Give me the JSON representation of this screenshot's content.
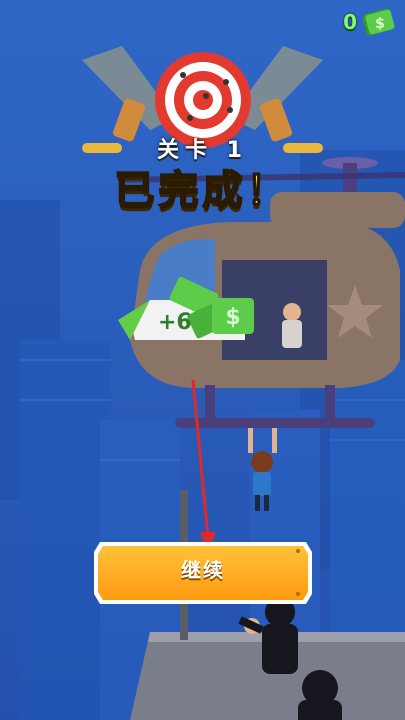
{
  "hud": {
    "cash_count": "0",
    "cash_icon": "cash-bill-icon"
  },
  "result": {
    "level_label": "关卡 1",
    "completed_text": "已完成！"
  },
  "reward": {
    "amount_text": "+6"
  },
  "actions": {
    "continue_label": "继续"
  },
  "colors": {
    "sky": "#2a5fbf",
    "button_orange": "#ffa51a",
    "cash_green": "#5ccc4a",
    "title_yellow": "#ffe82e"
  }
}
